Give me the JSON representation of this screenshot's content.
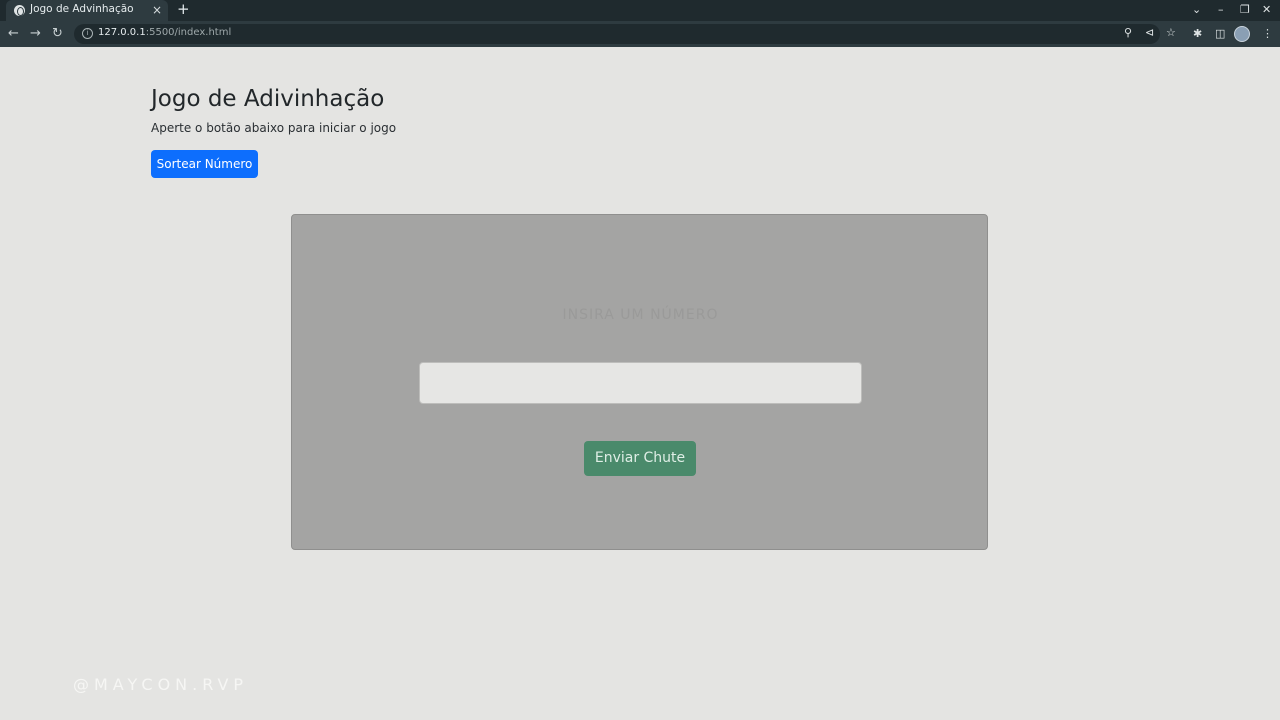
{
  "browser": {
    "tab_title": "Jogo de Advinhação",
    "close_glyph": "×",
    "new_tab_glyph": "+",
    "url_host": "127.0.0.1",
    "url_path": ":5500/index.html",
    "icons": [
      "back-icon",
      "forward-icon",
      "reload-icon",
      "zoom-icon",
      "share-icon",
      "star-icon",
      "extensions-icon",
      "sidepanel-icon",
      "profile-avatar",
      "menu-icon"
    ]
  },
  "page": {
    "heading": "Jogo de Adivinhação",
    "subtext": "Aperte o botão abaixo para iniciar o jogo",
    "draw_button": "Sortear Número",
    "card": {
      "hint": "INSIRA UM NÚMERO",
      "input_value": "",
      "submit_button": "Enviar Chute"
    }
  },
  "watermark": "@MAYCON.RVP",
  "colors": {
    "primary": "#0d6efd",
    "success": "#4a8a6b",
    "card_overlay": "#a4a4a3",
    "page_bg": "#e4e4e2"
  }
}
